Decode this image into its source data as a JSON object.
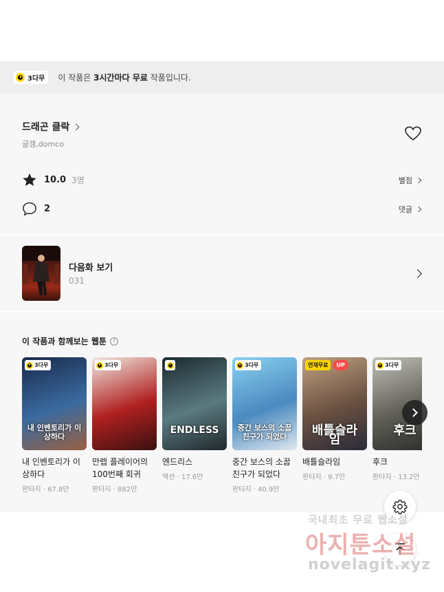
{
  "notice": {
    "badge": "3다무",
    "prefix": "이 작품은 ",
    "bold": "3시간마다 무료",
    "suffix": " 작품입니다."
  },
  "work": {
    "title": "드래곤 클락",
    "authors": "글갱,domco",
    "rating": "10.0",
    "rating_count": "3명",
    "rating_link": "별점",
    "comment_count": "2",
    "comment_link": "댓글"
  },
  "next_episode": {
    "label": "다음화 보기",
    "episode": "031"
  },
  "recommend": {
    "title": "이 작품과 함께보는 웹툰",
    "help": "?",
    "items": [
      {
        "title": "내 인벤토리가 이상하다",
        "genre": "판타지",
        "views": "67.8만",
        "badges": [
          "3다무"
        ],
        "cover_text": "내 인벤토리가 이상하다",
        "colors": [
          "#1a2a4a",
          "#3a6aa0",
          "#9a6040"
        ]
      },
      {
        "title": "만렙 플레이어의 100번째 회귀",
        "genre": "판타지",
        "views": "882만",
        "badges": [
          "3다무"
        ],
        "cover_text": "",
        "colors": [
          "#f0e8e0",
          "#b02020",
          "#3a1010"
        ]
      },
      {
        "title": "엔드리스",
        "genre": "액션",
        "views": "17.6만",
        "badges": [
          "clock"
        ],
        "cover_text": "ENDLESS",
        "colors": [
          "#1c2a30",
          "#5a7a80",
          "#20282c"
        ]
      },
      {
        "title": "중간 보스의 소꿉친구가 되었다",
        "genre": "판타지",
        "views": "40.9만",
        "badges": [
          "3다무"
        ],
        "cover_text": "중간 보스의 소꿉친구가 되었다",
        "colors": [
          "#8ad0f0",
          "#4a8ac0",
          "#e0e8f0"
        ]
      },
      {
        "title": "배틀슬라임",
        "genre": "판타지",
        "views": "9.7만",
        "badges": [
          "연재무료",
          "UP"
        ],
        "cover_text": "배틀슬라임",
        "colors": [
          "#c0a080",
          "#6a5040",
          "#2a2a3a"
        ]
      },
      {
        "title": "후크",
        "genre": "판타지",
        "views": "13.2만",
        "badges": [
          "3다무"
        ],
        "cover_text": "후크",
        "colors": [
          "#c0c0b8",
          "#606058",
          "#2a2a28"
        ]
      }
    ]
  },
  "watermark": {
    "line1": "국내최초 무료 웹소설",
    "line2": "아지툰소설",
    "line3": "novelagit.xyz"
  }
}
